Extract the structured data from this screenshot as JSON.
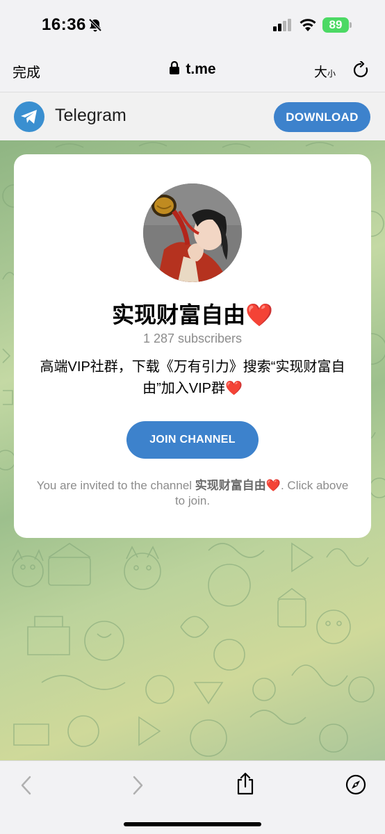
{
  "status_bar": {
    "time": "16:36",
    "battery": "89",
    "icons": [
      "bell-slash-icon",
      "cellular-signal-icon",
      "wifi-icon",
      "battery-icon"
    ]
  },
  "browser": {
    "done_label": "完成",
    "url": "t.me",
    "text_size_label_large": "大",
    "text_size_label_small": "小",
    "icons": [
      "lock-icon",
      "reload-icon"
    ]
  },
  "telegram_header": {
    "title": "Telegram",
    "download_label": "DOWNLOAD"
  },
  "card": {
    "channel_name": "实现财富自由",
    "heart": "❤️",
    "subscribers": "1 287 subscribers",
    "description_line1": "高端VIP社群，下载《万有引力》搜索“实现财富自",
    "description_line2": "由”加入VIP群",
    "join_label": "JOIN CHANNEL",
    "invite_prefix": "You are invited to the channel ",
    "invite_channel": "实现财富自由",
    "invite_suffix": ". Click above to join."
  },
  "toolbar": {
    "icons": [
      "back-icon",
      "forward-icon",
      "share-icon",
      "compass-icon"
    ]
  },
  "colors": {
    "accent": "#3d82cc",
    "telegram_logo": "#3a8fd0",
    "battery": "#4cd964",
    "heart": "#e5303a"
  }
}
